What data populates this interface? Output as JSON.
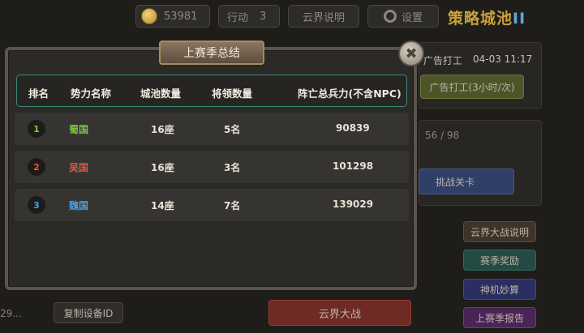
{
  "top_bar": {
    "gold": "53981",
    "action_label": "行动",
    "action_value": "3",
    "cloud_info_button": "云界说明",
    "settings_button": "设置",
    "logo_main": "策略城池",
    "logo_suffix": "II"
  },
  "background": {
    "ad_work_label": "广告打工",
    "ad_work_time": "04-03 11:17",
    "ad_work_button": "广告打工(3小时/次)",
    "progress_text": "56 / 98",
    "challenge_button": "挑战关卡",
    "side_buttons": [
      "云界大战说明",
      "赛季奖励",
      "神机妙算",
      "上赛季报告"
    ],
    "device_id_partial": "29...",
    "copy_device_button": "复制设备ID",
    "cloud_war_button": "云界大战"
  },
  "modal": {
    "title": "上赛季总结",
    "headers": [
      "排名",
      "势力名称",
      "城池数量",
      "将领数量",
      "阵亡总兵力(不含NPC)"
    ],
    "rows": [
      {
        "rank": "1",
        "name": "蜀国",
        "cities": "16座",
        "generals": "5名",
        "casualties": "90839",
        "color": "#7cc443"
      },
      {
        "rank": "2",
        "name": "吴国",
        "cities": "16座",
        "generals": "3名",
        "casualties": "101298",
        "color": "#e0583a"
      },
      {
        "rank": "3",
        "name": "魏国",
        "cities": "14座",
        "generals": "7名",
        "casualties": "139029",
        "color": "#4a9fe0"
      }
    ]
  }
}
